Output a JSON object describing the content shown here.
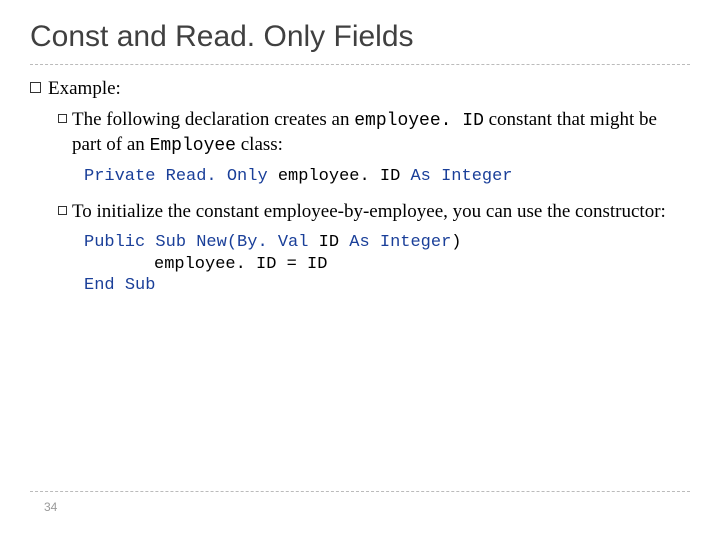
{
  "title": "Const and Read. Only Fields",
  "bullets": {
    "l1": "Example:",
    "sub1_a": "The following declaration creates an ",
    "sub1_code": "employee. ID",
    "sub1_b": " constant that might be part of an ",
    "sub1_code2": "Employee",
    "sub1_c": " class:",
    "sub2_a": "To initialize the constant employee-by-employee, you can use the constructor:"
  },
  "code1": {
    "kw1": "Private",
    "kw2": "Read. Only",
    "mid": " employee. ID ",
    "kw3": "As Integer"
  },
  "code2": {
    "kw1": "Public",
    "kw2": "Sub",
    "kw3": "New(By. Val",
    "mid1": " ID ",
    "kw4": "As Integer",
    "paren": ")",
    "line2": "employee. ID = ID",
    "kw5": "End",
    "kw6": "Sub"
  },
  "page_number": "34"
}
